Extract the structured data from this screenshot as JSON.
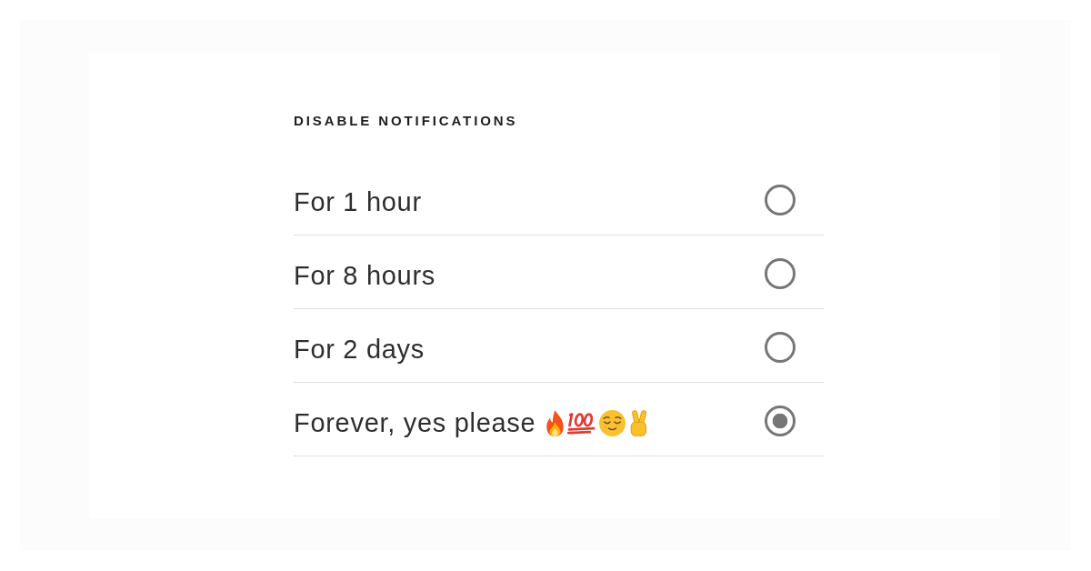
{
  "panel": {
    "heading": "DISABLE NOTIFICATIONS",
    "options": [
      {
        "label": "For 1 hour",
        "selected": false
      },
      {
        "label": "For 8 hours",
        "selected": false
      },
      {
        "label": "For 2 days",
        "selected": false
      },
      {
        "label": "Forever, yes please",
        "selected": true,
        "emojis": [
          {
            "kind": "fire"
          },
          {
            "kind": "hundred-points"
          },
          {
            "kind": "relieved-face"
          },
          {
            "kind": "victory-hand"
          }
        ]
      }
    ]
  }
}
